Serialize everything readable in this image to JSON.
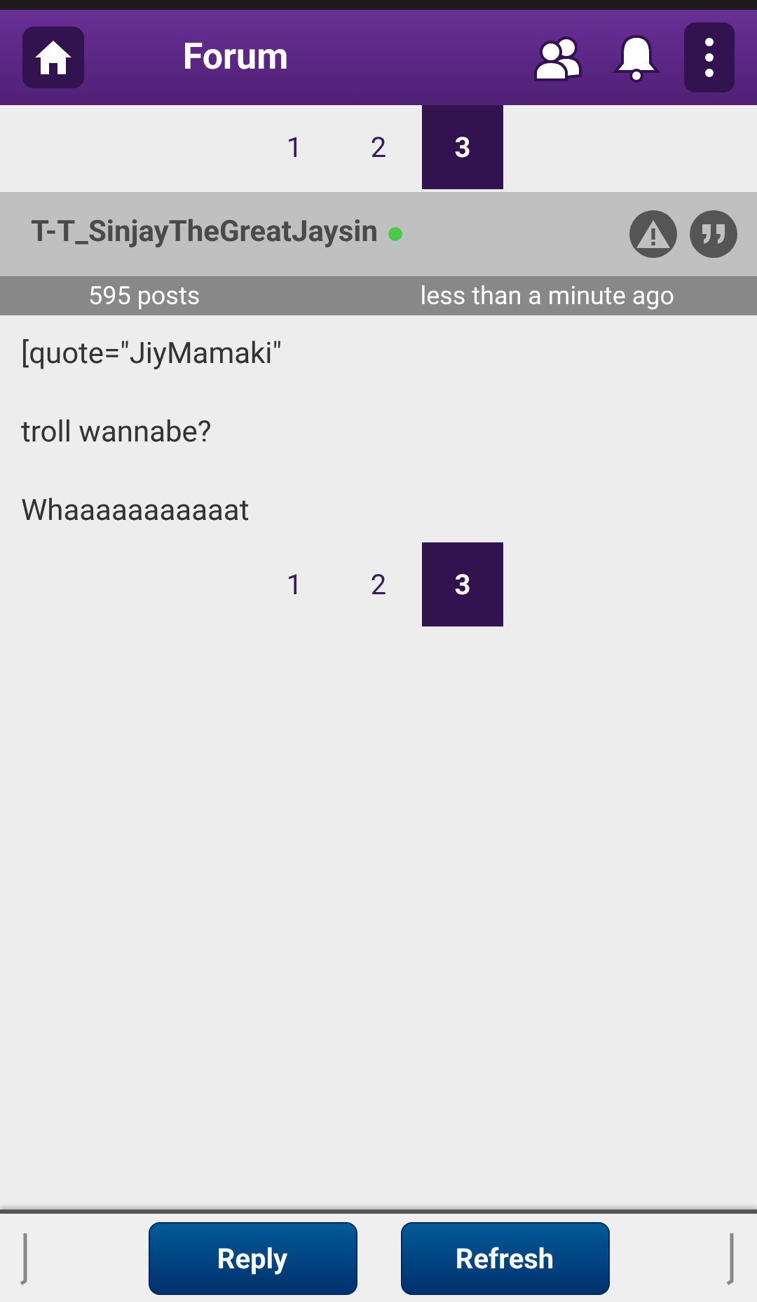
{
  "header": {
    "title": "Forum"
  },
  "pager_top": [
    {
      "label": "1",
      "selected": false
    },
    {
      "label": "2",
      "selected": false
    },
    {
      "label": "3",
      "selected": true
    }
  ],
  "post": {
    "author": "T-T_SinjayTheGreatJaysin",
    "online": true,
    "posts": "595 posts",
    "time": "less than a minute ago",
    "paragraphs": [
      "[quote=\"JiyMamaki\"",
      "troll wannabe?",
      "Whaaaaaaaaaaat"
    ]
  },
  "pager_bottom": [
    {
      "label": "1",
      "selected": false
    },
    {
      "label": "2",
      "selected": false
    },
    {
      "label": "3",
      "selected": true
    }
  ],
  "buttons": [
    "Reply",
    "Refresh"
  ]
}
